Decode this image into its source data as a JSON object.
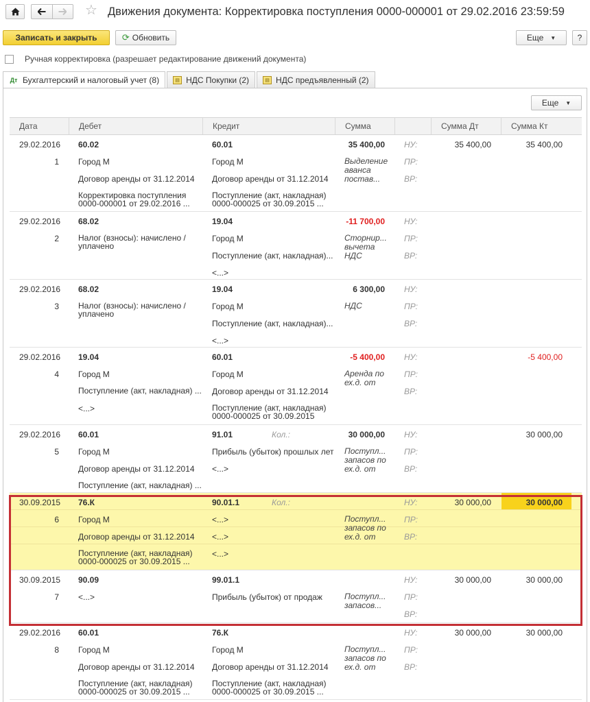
{
  "window": {
    "title": "Движения документа: Корректировка поступления 0000-000001 от 29.02.2016 23:59:59"
  },
  "toolbar": {
    "save_close": "Записать и закрыть",
    "refresh": "Обновить",
    "more": "Еще",
    "help": "?"
  },
  "manual_correction_label": "Ручная корректировка (разрешает редактирование движений документа)",
  "tabs": [
    {
      "label": "Бухгалтерский и налоговый учет (8)",
      "active": true
    },
    {
      "label": "НДС Покупки (2)",
      "active": false
    },
    {
      "label": "НДС предъявленный (2)",
      "active": false
    }
  ],
  "table": {
    "more": "Еще",
    "columns": {
      "date": "Дата",
      "debit": "Дебет",
      "credit": "Кредит",
      "sum": "Сумма",
      "sum_dt": "Сумма Дт",
      "sum_kt": "Сумма Кт"
    },
    "reg_labels": {
      "nu": "НУ:",
      "pr": "ПР:",
      "vr": "ВР:"
    },
    "qty_label": "Кол.:",
    "rows": [
      {
        "date": "29.02.2016",
        "num": "1",
        "debit_account": "60.02",
        "debit_sub1": "Город М",
        "debit_sub2": "Договор аренды от 31.12.2014",
        "debit_sub3": "Корректировка поступления 0000-000001 от 29.02.2016 ...",
        "credit_account": "60.01",
        "credit_sub1": "Город М",
        "credit_sub2": "Договор аренды от 31.12.2014",
        "credit_sub3": "Поступление (акт, накладная) 0000-000025 от 30.09.2015 ...",
        "sum": "35 400,00",
        "content": "Выделение аванса постав...",
        "sum_dt": "35 400,00",
        "sum_kt": "35 400,00"
      },
      {
        "date": "29.02.2016",
        "num": "2",
        "debit_account": "68.02",
        "debit_sub1": "Налог (взносы): начислено / уплачено",
        "credit_account": "19.04",
        "credit_sub1": "Город М",
        "credit_sub2": "Поступление (акт, накладная)...",
        "credit_sub3": "<...>",
        "sum": "-11 700,00",
        "content": "Сторнир... вычета НДС"
      },
      {
        "date": "29.02.2016",
        "num": "3",
        "debit_account": "68.02",
        "debit_sub1": "Налог (взносы): начислено / уплачено",
        "credit_account": "19.04",
        "credit_sub1": "Город М",
        "credit_sub2": "Поступление (акт, накладная)...",
        "credit_sub3": "<...>",
        "sum": "6 300,00",
        "content": "НДС"
      },
      {
        "date": "29.02.2016",
        "num": "4",
        "debit_account": "19.04",
        "debit_sub1": "Город М",
        "debit_sub2": "Поступление (акт, накладная) ...",
        "debit_sub3": "<...>",
        "credit_account": "60.01",
        "credit_sub1": "Город М",
        "credit_sub2": "Договор аренды от 31.12.2014",
        "credit_sub3": "Поступление (акт, накладная) 0000-000025 от 30.09.2015",
        "sum": "-5 400,00",
        "content": "Аренда по ех.д. от",
        "sum_kt": "-5 400,00"
      },
      {
        "date": "29.02.2016",
        "num": "5",
        "debit_account": "60.01",
        "debit_sub1": "Город М",
        "debit_sub2": "Договор аренды от 31.12.2014",
        "debit_sub3": "Поступление (акт, накладная) ...",
        "credit_account": "91.01",
        "credit_sub1": "Прибыль (убыток) прошлых лет",
        "credit_sub2": "<...>",
        "sum": "30 000,00",
        "content": "Поступл... запасов по ех.д. от",
        "sum_kt": "30 000,00"
      },
      {
        "date": "30.09.2015",
        "num": "6",
        "debit_account": "76.К",
        "debit_sub1": "Город М",
        "debit_sub2": "Договор аренды от 31.12.2014",
        "debit_sub3": "Поступление (акт, накладная) 0000-000025 от 30.09.2015 ...",
        "credit_account": "90.01.1",
        "credit_sub1": "<...>",
        "credit_sub2": "<...>",
        "credit_sub3": "<...>",
        "content": "Поступл... запасов по ех.д. от",
        "sum_dt": "30 000,00",
        "sum_kt": "30 000,00"
      },
      {
        "date": "30.09.2015",
        "num": "7",
        "debit_account": "90.09",
        "debit_sub1": "<...>",
        "credit_account": "99.01.1",
        "credit_sub1": "Прибыль (убыток) от продаж",
        "content": "Поступл... запасов...",
        "sum_dt": "30 000,00",
        "sum_kt": "30 000,00"
      },
      {
        "date": "29.02.2016",
        "num": "8",
        "debit_account": "60.01",
        "debit_sub1": "Город М",
        "debit_sub2": "Договор аренды от 31.12.2014",
        "debit_sub3": "Поступление (акт, накладная) 0000-000025 от 30.09.2015 ...",
        "credit_account": "76.К",
        "credit_sub1": "Город М",
        "credit_sub2": "Договор аренды от 31.12.2014",
        "credit_sub3": "Поступление (акт, накладная) 0000-000025 от 30.09.2015 ...",
        "content": "Поступл... запасов по ех.д. от",
        "sum_dt": "30 000,00",
        "sum_kt": "30 000,00"
      }
    ]
  },
  "colors": {
    "highlight_row": "#fdf7ab",
    "highlight_cell": "#f8d21c",
    "negative": "#e02020",
    "frame": "#c42f35",
    "primary_button": "#f2cf33"
  }
}
